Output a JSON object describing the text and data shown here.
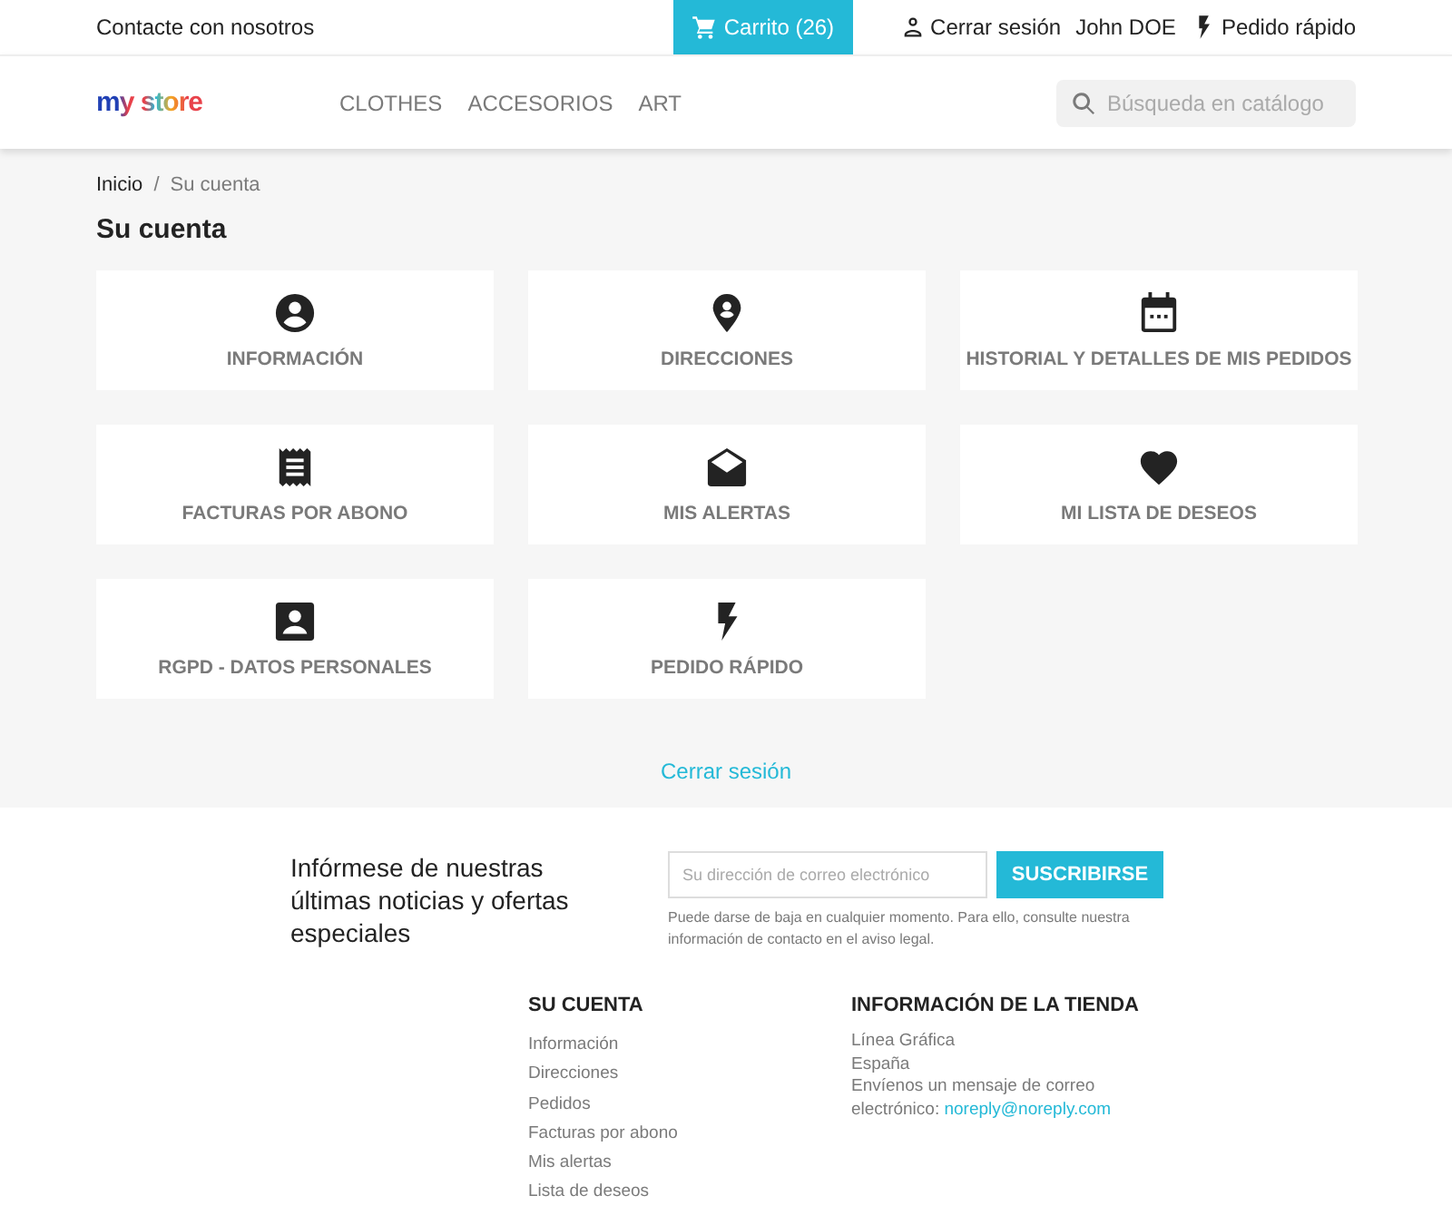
{
  "top_bar": {
    "contact": "Contacte con nosotros",
    "cart": "Carrito (26)",
    "logout": "Cerrar sesión",
    "user": "John DOE",
    "quick_order": "Pedido rápido"
  },
  "header": {
    "logo": "my store",
    "menu": [
      "CLOTHES",
      "ACCESORIOS",
      "ART"
    ],
    "search": {
      "placeholder": "Búsqueda en catálogo"
    }
  },
  "breadcrumb": [
    "Inicio",
    "/",
    "Su cuenta"
  ],
  "title": "Su cuenta",
  "cards": [
    {
      "label": "INFORMACIÓN"
    },
    {
      "label": "DIRECCIONES"
    },
    {
      "label": "HISTORIAL Y DETALLES DE MIS PEDIDOS"
    },
    {
      "label": "FACTURAS POR ABONO"
    },
    {
      "label": "MIS ALERTAS"
    },
    {
      "label": "MI LISTA DE DESEOS"
    },
    {
      "label": "RGPD - DATOS PERSONALES"
    },
    {
      "label": "PEDIDO RÁPIDO"
    }
  ],
  "logout_link": "Cerrar sesión",
  "newsletter": {
    "text": "Infórmese de nuestras últimas noticias y ofertas especiales",
    "email": {
      "placeholder": "Su dirección de correo electrónico"
    },
    "button": "SUSCRIBIRSE",
    "note": "Puede darse de baja en cualquier momento. Para ello, consulte nuestra información de contacto en el aviso legal."
  },
  "footer": {
    "account": {
      "title": "SU CUENTA",
      "links": [
        "Información",
        "Direcciones",
        "Pedidos",
        "Facturas por abono",
        "Mis alertas",
        "Lista de deseos"
      ]
    },
    "store": {
      "title": "INFORMACIÓN DE LA TIENDA",
      "lines": [
        "Línea Gráfica",
        "España",
        "Envíenos un mensaje de correo electrónico:"
      ],
      "email": "noreply@noreply.com"
    }
  }
}
